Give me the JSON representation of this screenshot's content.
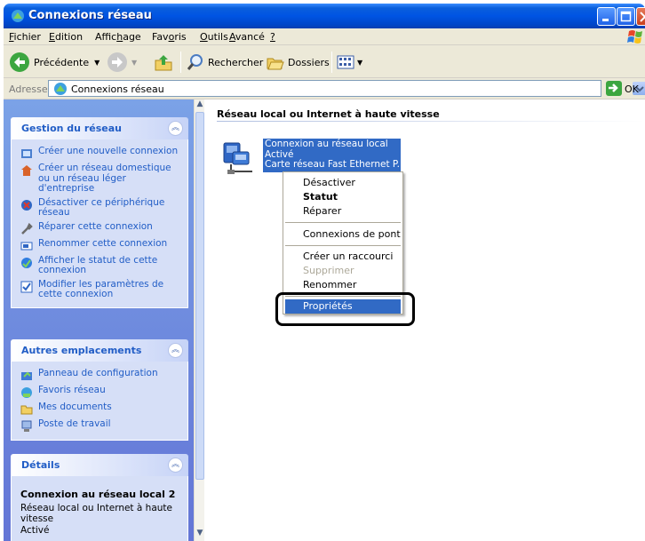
{
  "window": {
    "title": "Connexions réseau"
  },
  "menu": {
    "items": [
      {
        "label": "Fichier",
        "u": "F"
      },
      {
        "label": "Edition",
        "u": "E"
      },
      {
        "label": "Affichage",
        "u": "h"
      },
      {
        "label": "Favoris",
        "u": "o"
      },
      {
        "label": "Outils",
        "u": "O"
      },
      {
        "label": "Avancé",
        "u": "A"
      },
      {
        "label": "?",
        "u": "?"
      }
    ]
  },
  "toolbar": {
    "back_label": "Précédente",
    "search_label": "Rechercher",
    "folders_label": "Dossiers"
  },
  "address": {
    "label": "Adresse",
    "value": "Connexions réseau",
    "go_label": "OK"
  },
  "sidebar": {
    "network_tasks": {
      "title": "Gestion du réseau",
      "items": [
        "Créer une nouvelle connexion",
        "Créer un réseau domestique ou un réseau léger d'entreprise",
        "Désactiver ce périphérique réseau",
        "Réparer cette connexion",
        "Renommer cette connexion",
        "Afficher le statut de cette connexion",
        "Modifier les paramètres de cette connexion"
      ]
    },
    "other_places": {
      "title": "Autres emplacements",
      "items": [
        "Panneau de configuration",
        "Favoris réseau",
        "Mes documents",
        "Poste de travail"
      ]
    },
    "details": {
      "title": "Détails",
      "name": "Connexion au réseau local 2",
      "type": "Réseau local ou Internet à haute vitesse",
      "status": "Activé"
    }
  },
  "content": {
    "group_header": "Réseau local ou Internet à haute vitesse",
    "connection": {
      "name": "Connexion au réseau local",
      "status": "Activé",
      "device": "Carte réseau Fast Ethernet P..."
    }
  },
  "context_menu": {
    "items": [
      {
        "label": "Désactiver",
        "style": "normal"
      },
      {
        "label": "Statut",
        "style": "bold"
      },
      {
        "label": "Réparer",
        "style": "normal"
      },
      {
        "label": "Connexions de pont",
        "style": "normal"
      },
      {
        "label": "Créer un raccourci",
        "style": "normal"
      },
      {
        "label": "Supprimer",
        "style": "disabled"
      },
      {
        "label": "Renommer",
        "style": "normal"
      },
      {
        "label": "Propriétés",
        "style": "selected"
      }
    ]
  },
  "colors": {
    "title_bar": "#0054e3",
    "task_link": "#215dc6",
    "selection": "#316ac5",
    "sidebar_bg": "#7ba2e7"
  }
}
